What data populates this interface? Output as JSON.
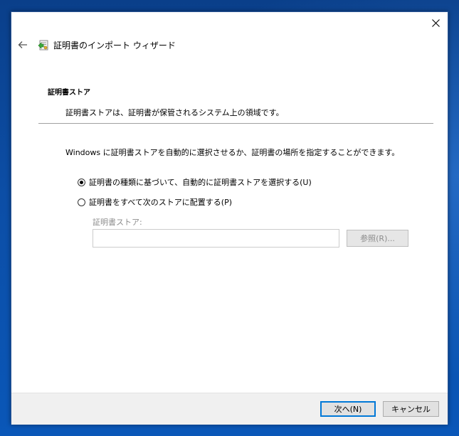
{
  "wizard": {
    "title": "証明書のインポート ウィザード",
    "back_icon": "back-arrow-icon",
    "wizard_icon": "certificate-import-icon",
    "close_icon": "close-icon"
  },
  "section": {
    "title": "証明書ストア",
    "description": "証明書ストアは、証明書が保管されるシステム上の領域です。"
  },
  "main": {
    "instruction": "Windows に証明書ストアを自動的に選択させるか、証明書の場所を指定することができます。",
    "options": [
      {
        "label": "証明書の種類に基づいて、自動的に証明書ストアを選択する(U)",
        "selected": true
      },
      {
        "label": "証明書をすべて次のストアに配置する(P)",
        "selected": false
      }
    ],
    "store_label": "証明書ストア:",
    "store_value": "",
    "browse_label": "参照(R)..."
  },
  "footer": {
    "next_label": "次へ(N)",
    "cancel_label": "キャンセル"
  },
  "colors": {
    "focus_blue": "#0078d7",
    "desktop_blue": "#0c4ea6",
    "disabled_text": "#8c8c8c"
  }
}
